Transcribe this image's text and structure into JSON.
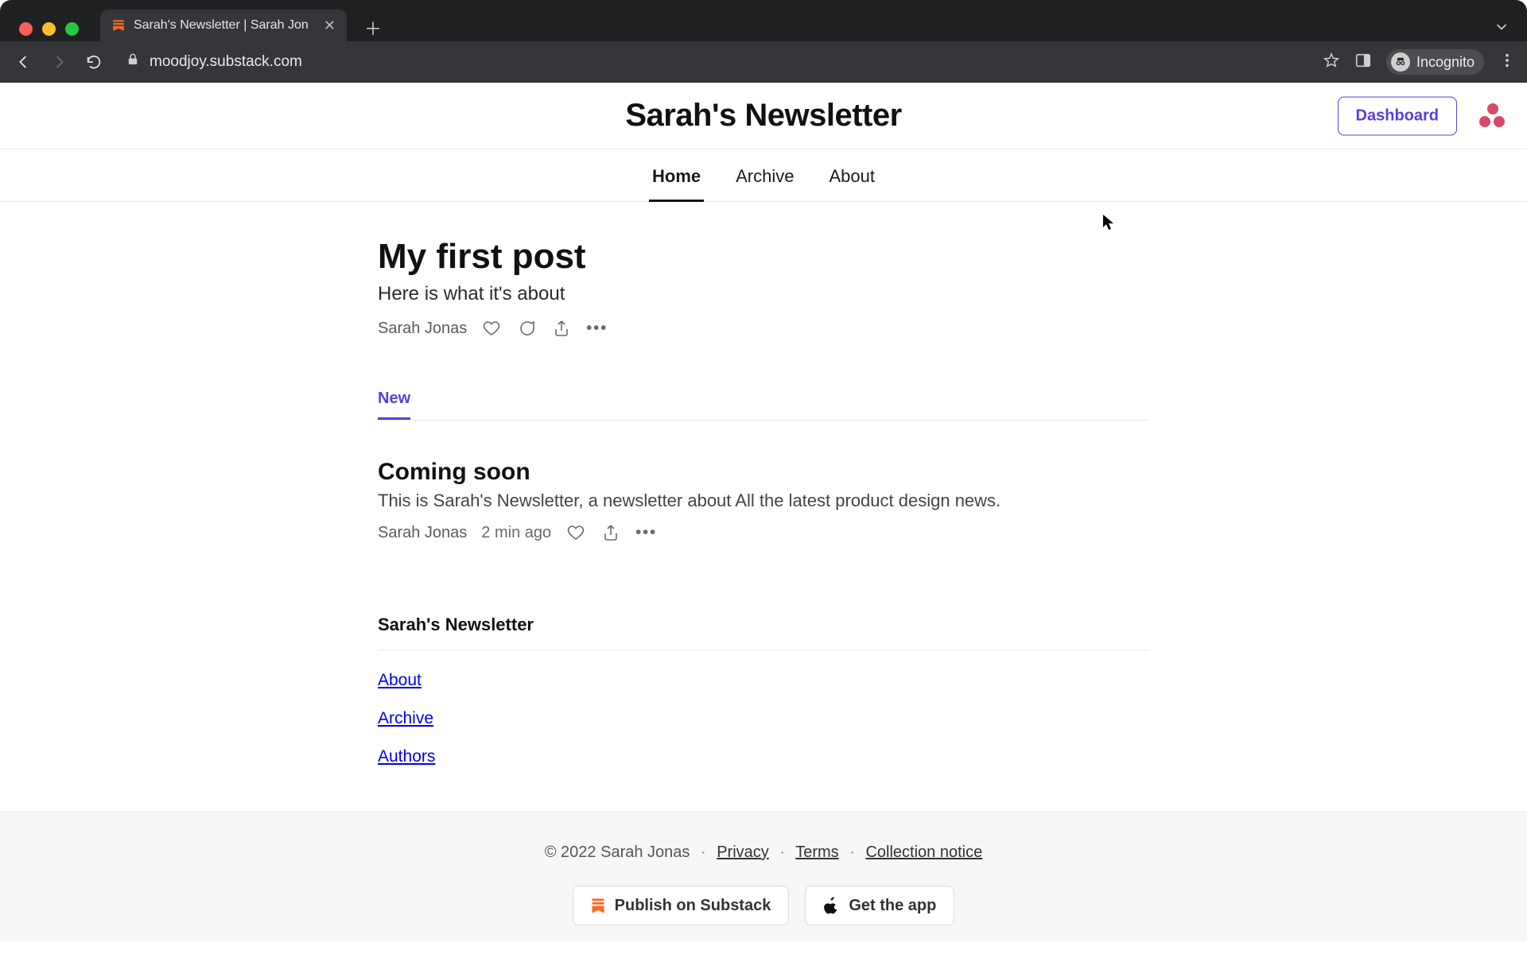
{
  "browser": {
    "tab_title": "Sarah's Newsletter | Sarah Jon",
    "url": "moodjoy.substack.com",
    "incognito_label": "Incognito"
  },
  "header": {
    "site_title": "Sarah's Newsletter",
    "dashboard_label": "Dashboard"
  },
  "nav": {
    "items": [
      "Home",
      "Archive",
      "About"
    ]
  },
  "featured": {
    "title": "My first post",
    "subtitle": "Here is what it's about",
    "author": "Sarah Jonas"
  },
  "filter": {
    "new_label": "New"
  },
  "posts": [
    {
      "title": "Coming soon",
      "desc": "This is Sarah's Newsletter, a newsletter about All the latest product design news.",
      "author": "Sarah Jonas",
      "time": "2 min ago"
    }
  ],
  "footer_block": {
    "title": "Sarah's Newsletter",
    "links": [
      "About",
      "Archive",
      "Authors"
    ]
  },
  "legal": {
    "copyright": "© 2022 Sarah Jonas",
    "privacy": "Privacy",
    "terms": "Terms",
    "collection": "Collection notice"
  },
  "cta": {
    "publish": "Publish on Substack",
    "app": "Get the app"
  }
}
